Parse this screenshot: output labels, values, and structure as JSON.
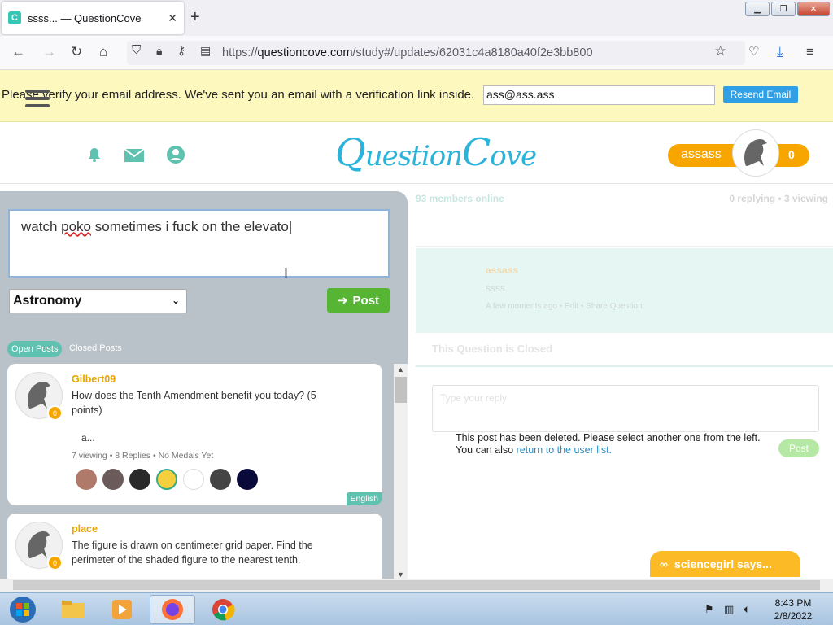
{
  "browser": {
    "tab_title": "ssss... — QuestionCove",
    "favicon_letter": "C",
    "url_prefix": "https://",
    "url_domain": "questioncove.com",
    "url_path": "/study#/updates/62031c4a8180a40f2e3bb800"
  },
  "verify_banner": {
    "text": "Please verify your email address. We've sent you an email with a verification link inside.",
    "email_value": "ass@ass.ass",
    "resend_label": "Resend Email"
  },
  "header": {
    "logo_q": "Q",
    "logo_rest": "uestion",
    "logo_c": "C",
    "logo_end": "ove",
    "username": "assass",
    "user_points": "0"
  },
  "compose": {
    "text_word": "watch ",
    "text_misspelled": "poko",
    "text_rest": "  sometimes i fuck on the elevato",
    "subject": "Astronomy",
    "post_label": "Post"
  },
  "filters": {
    "open": "Open Posts",
    "closed": "Closed Posts"
  },
  "posts": [
    {
      "user": "Gilbert09",
      "question": "How does the Tenth Amendment benefit you today? (5 points)",
      "extra": "a...",
      "meta": "7 viewing  •  8 Replies  •  No Medals Yet",
      "badge": "0",
      "lang": "English"
    },
    {
      "user": "place",
      "question": "The figure is drawn on centimeter grid paper. Find the perimeter of the shaded figure to the nearest tenth.",
      "badge": "0"
    }
  ],
  "right": {
    "online": "93 members online",
    "viewing": "0 replying  •  3 viewing",
    "q_user": "assass",
    "q_text": "ssss",
    "q_meta": "A few moments ago  •  Edit  •  Share Question:",
    "closed_title": "This Question is Closed",
    "reply_placeholder": "Type your reply",
    "deleted_line1": "This post has been deleted. Please select another one from the left.",
    "deleted_line2": "You can also ",
    "deleted_link": "return to the user list.",
    "post_label": "Post",
    "says": "sciencegirl says..."
  },
  "taskbar": {
    "time": "8:43 PM",
    "date": "2/8/2022"
  },
  "colors": {
    "teal": "#5fc1b0",
    "orange": "#f7a600",
    "green": "#56b533",
    "banner": "#fdf8be"
  }
}
